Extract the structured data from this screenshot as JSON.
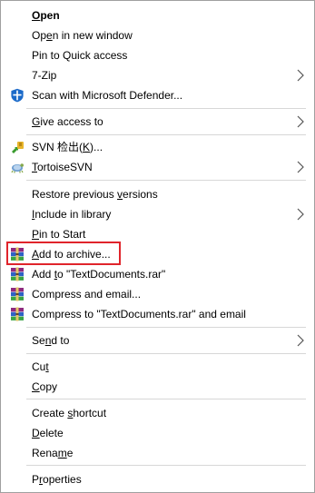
{
  "menu": {
    "items": [
      {
        "pre": "",
        "u": "O",
        "post": "pen"
      },
      {
        "pre": "Op",
        "u": "e",
        "post": "n in new window"
      },
      {
        "pre": "Pin to Quick access",
        "u": "",
        "post": ""
      },
      {
        "pre": "7-Zip",
        "u": "",
        "post": ""
      },
      {
        "pre": "Scan with Microsoft Defender...",
        "u": "",
        "post": ""
      },
      {
        "pre": "",
        "u": "G",
        "post": "ive access to"
      },
      {
        "pre": "SVN 检出(",
        "u": "K",
        "post": ")..."
      },
      {
        "pre": "",
        "u": "T",
        "post": "ortoiseSVN"
      },
      {
        "pre": "Restore previous ",
        "u": "v",
        "post": "ersions"
      },
      {
        "pre": "",
        "u": "I",
        "post": "nclude in library"
      },
      {
        "pre": "",
        "u": "P",
        "post": "in to Start"
      },
      {
        "pre": "",
        "u": "A",
        "post": "dd to archive..."
      },
      {
        "pre": "Add ",
        "u": "t",
        "post": "o \"TextDocuments.rar\""
      },
      {
        "pre": "Compress and email...",
        "u": "",
        "post": ""
      },
      {
        "pre": "Compress to \"TextDocuments.rar\" and email",
        "u": "",
        "post": ""
      },
      {
        "pre": "Se",
        "u": "n",
        "post": "d to"
      },
      {
        "pre": "Cu",
        "u": "t",
        "post": ""
      },
      {
        "pre": "",
        "u": "C",
        "post": "opy"
      },
      {
        "pre": "Create ",
        "u": "s",
        "post": "hortcut"
      },
      {
        "pre": "",
        "u": "D",
        "post": "elete"
      },
      {
        "pre": "Rena",
        "u": "m",
        "post": "e"
      },
      {
        "pre": "P",
        "u": "r",
        "post": "operties"
      }
    ]
  },
  "colors": {
    "highlight_border": "#e0242b",
    "separator": "#d7d7d7",
    "menu_border": "#a0a0a0"
  }
}
